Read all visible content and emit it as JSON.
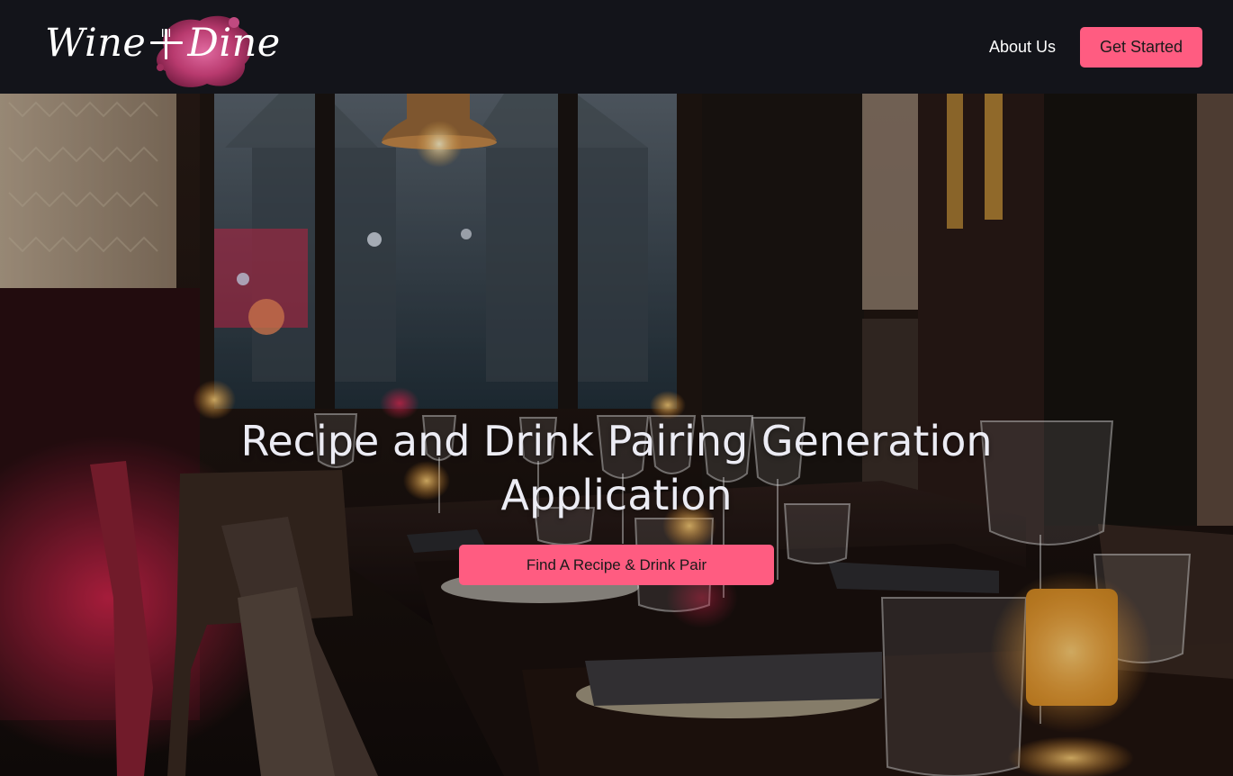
{
  "brand": {
    "word_left": "Wine",
    "word_right": "Dine",
    "icon": "fork-knife-icon",
    "splash_color": "#c8487a"
  },
  "nav": {
    "about_label": "About Us",
    "cta_label": "Get Started"
  },
  "hero": {
    "title": "Recipe and Drink Pairing Generation Application",
    "button_label": "Find A Recipe & Drink Pair",
    "background": "restaurant-interior-photo"
  },
  "colors": {
    "navbar_bg": "#13141a",
    "accent": "#ff5c81",
    "text_light": "#ffffff"
  }
}
